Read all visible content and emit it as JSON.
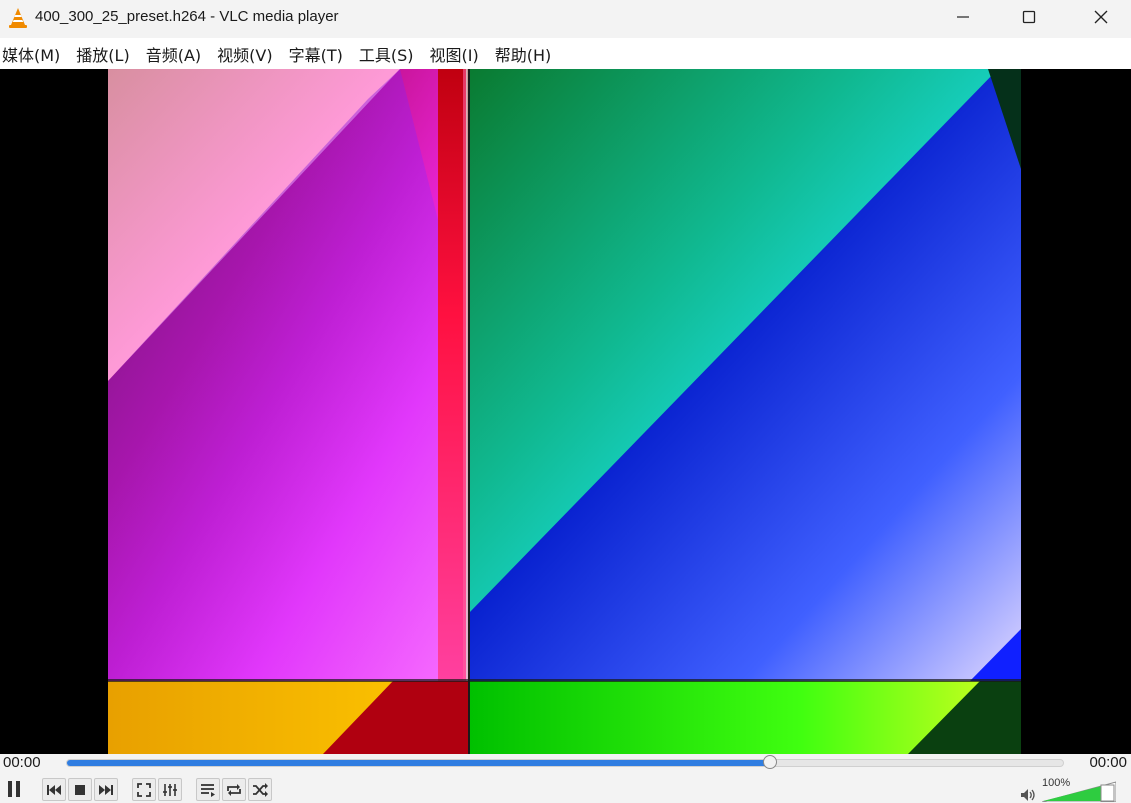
{
  "window": {
    "title": "400_300_25_preset.h264 - VLC media player"
  },
  "menu": {
    "items": [
      {
        "label": "媒体(M)"
      },
      {
        "label": "播放(L)"
      },
      {
        "label": "音频(A)"
      },
      {
        "label": "视频(V)"
      },
      {
        "label": "字幕(T)"
      },
      {
        "label": "工具(S)"
      },
      {
        "label": "视图(I)"
      },
      {
        "label": "帮助(H)"
      }
    ]
  },
  "playback": {
    "elapsed": "00:00",
    "remaining": "00:00",
    "progress_fraction": 0.705
  },
  "volume": {
    "label": "100%",
    "level_fraction": 1.0
  },
  "colors": {
    "accent": "#2f7de1",
    "volume_green": "#2ecc40",
    "vlc_orange": "#f08a00"
  },
  "icons": {
    "app": "vlc-cone-icon",
    "minimize": "minimize-icon",
    "maximize": "maximize-icon",
    "close": "close-icon",
    "pause": "pause-icon",
    "previous": "previous-icon",
    "stop": "stop-icon",
    "next": "next-icon",
    "fullscreen": "fullscreen-icon",
    "extended": "extended-settings-icon",
    "playlist": "playlist-icon",
    "loop": "loop-icon",
    "shuffle": "shuffle-icon",
    "speaker": "speaker-icon"
  }
}
